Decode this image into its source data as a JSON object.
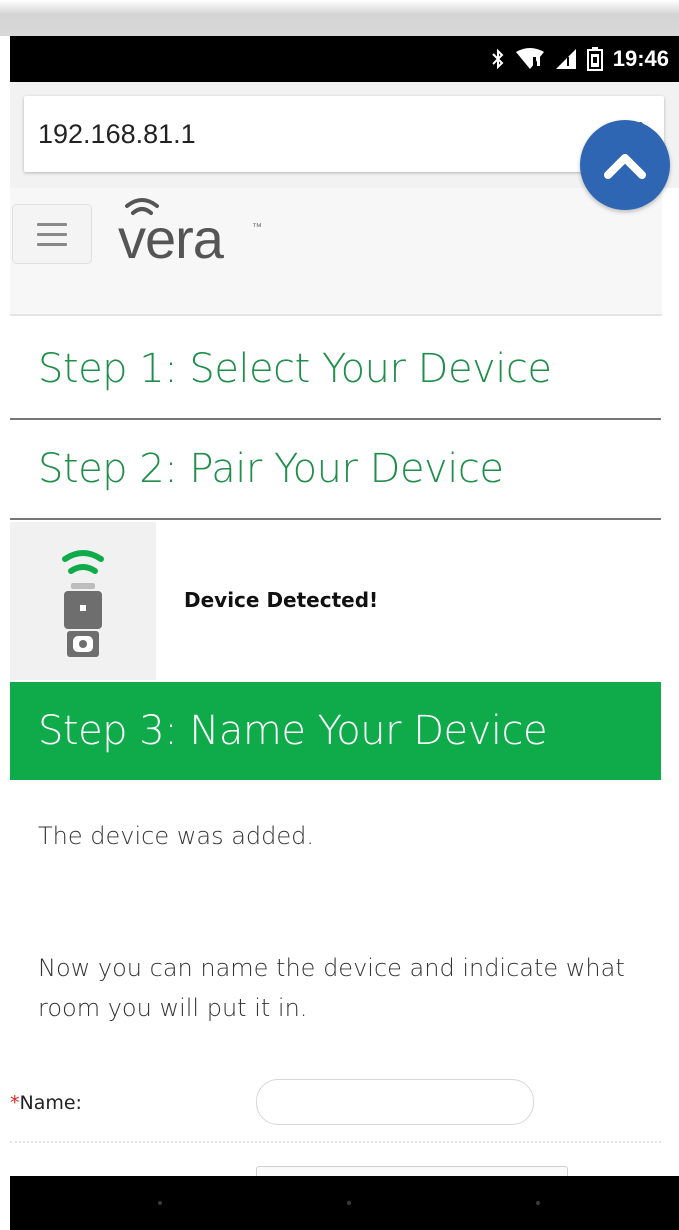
{
  "status_bar": {
    "time": "19:46",
    "icons": [
      "bluetooth-icon",
      "wifi-icon",
      "cell-signal-icon",
      "battery-icon"
    ]
  },
  "browser": {
    "url": "192.168.81.1",
    "scroll_up_icon": "chevron-up-icon"
  },
  "site": {
    "logo_text": "vera",
    "logo_trademark": "™",
    "menu_icon": "hamburger-icon"
  },
  "steps": {
    "step1": "Step 1: Select Your Device",
    "step2": "Step 2: Pair Your Device",
    "step3": "Step 3: Name Your Device"
  },
  "pairing": {
    "status": "Device Detected!",
    "device_icon": "smart-plug-icon"
  },
  "content": {
    "added_message": "The device was added.",
    "instructions": "Now you can name the device and indicate what room you will put it in."
  },
  "form": {
    "name_required_marker": "*",
    "name_label": "Name:",
    "name_value": ""
  },
  "colors": {
    "accent_green": "#0fab4b",
    "step_text_green": "#1e8e4a",
    "scroll_button_blue": "#2f66b3"
  }
}
